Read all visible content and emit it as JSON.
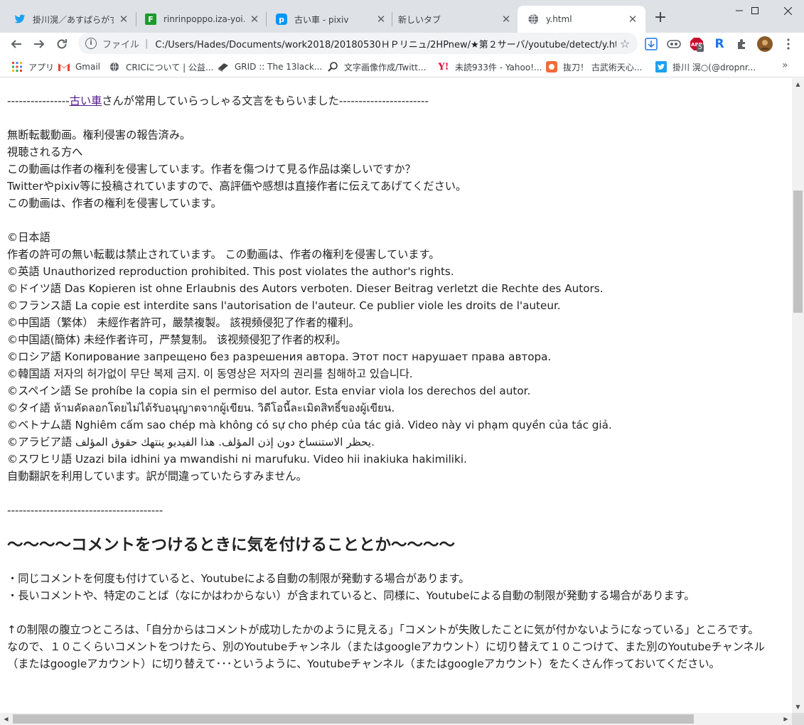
{
  "tabs": [
    {
      "title": "掛川滉／あすぱらがす@",
      "favicon": "twitter-icon",
      "color": "#1da1f2"
    },
    {
      "title": "rinrinpoppo.iza-yoi.ne",
      "favicon": "f-site-icon",
      "color": "#1a9c2a"
    },
    {
      "title": "古い車 - pixiv",
      "favicon": "pixiv-icon",
      "color": "#0096fa"
    },
    {
      "title": "新しいタブ",
      "favicon": "",
      "color": ""
    },
    {
      "title": "y.html",
      "favicon": "globe-icon",
      "color": "#5f6368"
    }
  ],
  "window": {
    "minimize": "—",
    "maximize": "☐",
    "close": "✕"
  },
  "omnibox": {
    "info": "i",
    "scheme": "ファイル",
    "pipe": "|",
    "url": "C:/Users/Hades/Documents/work2018/20180530ＨＰリニュ/2HPnew/★第２サーバ/youtube/detect/y.html"
  },
  "extensions": {
    "abp_badge": "5"
  },
  "bookmarks": [
    {
      "label": "アプリ",
      "icon": "apps-grid-icon"
    },
    {
      "label": "Gmail",
      "icon": "gmail-icon"
    },
    {
      "label": "CRICについて | 公益...",
      "icon": "globe-icon"
    },
    {
      "label": "GRID :: The 13lack...",
      "icon": "grid-site-icon"
    },
    {
      "label": "文字画像作成/Twitt...",
      "icon": "search-icon"
    },
    {
      "label": "未読933件 - Yahoo!...",
      "icon": "yahoo-icon"
    },
    {
      "label": "抜刀！ 古武術天心...",
      "icon": "site-icon"
    },
    {
      "label": "掛川 滉○(@dropnr...",
      "icon": "twitter-icon"
    }
  ],
  "bookmarks_more": "»",
  "content": {
    "header_prefix": "----------------",
    "header_link": "古い車",
    "header_suffix": "さんが常用していらっしゃる文言をもらいました-----------------------",
    "notice": [
      "無断転載動画。権利侵害の報告済み。",
      "視聴される方へ",
      "この動画は作者の権利を侵害しています。作者を傷つけて見る作品は楽しいですか？",
      "Twitterやpixiv等に投稿されていますので、高評価や感想は直接作者に伝えてあげてください。",
      "この動画は、作者の権利を侵害しています。"
    ],
    "languages": [
      "©日本語",
      "作者の許可の無い転載は禁止されています。 この動画は、作者の権利を侵害しています。",
      "©英語 Unauthorized reproduction prohibited. This post violates the author's rights.",
      "©ドイツ語 Das Kopieren ist ohne Erlaubnis des Autors verboten. Dieser Beitrag verletzt die Rechte des Autors.",
      "©フランス語 La copie est interdite sans l'autorisation de l'auteur. Ce publier viole les droits de l'auteur.",
      "©中国語（繁体） 未經作者許可，嚴禁複製。 該視頻侵犯了作者的權利。",
      "©中国語(簡体) 未经作者许可，严禁复制。 该视频侵犯了作者的权利。",
      "©ロシア語 Копирование запрещено без разрешения автора. Этот пост нарушает права автора.",
      "©韓国語 저자의 허가없이 무단 복제 금지. 이 동영상은 저자의 권리를 침해하고 있습니다.",
      "©スペイン語 Se prohíbe la copia sin el permiso del autor. Esta enviar viola los derechos del autor.",
      "©タイ語 ห้ามคัดลอกโดยไม่ได้รับอนุญาตจากผู้เขียน. วิดีโอนี้ละเมิดสิทธิ์ของผู้เขียน.",
      "©ベトナム語 Nghiêm cấm sao chép mà không có sự cho phép của tác giả. Video này vi phạm quyền của tác giả.",
      "©アラビア語 يحظر الاستنساخ دون إذن المؤلف. هذا الفيديو ينتهك حقوق المؤلف.",
      "©スワヒリ語 Uzazi bila idhini ya mwandishi ni marufuku. Video hii inakiuka hakimiliki.",
      "自動翻訳を利用しています。訳が間違っていたらすみません。"
    ],
    "divider": "----------------------------------------",
    "heading": "～～～～コメントをつけるときに気を付けることとか～～～～",
    "bullets": [
      "・同じコメントを何度も付けていると、Youtubeによる自動の制限が発動する場合があります。",
      "・長いコメントや、特定のことば（なにかはわからない）が含まれていると、同様に、Youtubeによる自動の制限が発動する場合があります。"
    ],
    "para1": "↑の制限の腹立つところは、「自分からはコメントが成功したかのように見える」「コメントが失敗したことに気が付かないようになっている」ところです。",
    "para2": "なので、１０こくらいコメントをつけたら、別のYoutubeチャンネル（またはgoogleアカウント）に切り替えて１０こつけて、また別のYoutubeチャンネル（またはgoogleアカウント）に切り替えて･･･というように、Youtubeチャンネル（またはgoogleアカウント）をたくさん作っておいてください。"
  }
}
